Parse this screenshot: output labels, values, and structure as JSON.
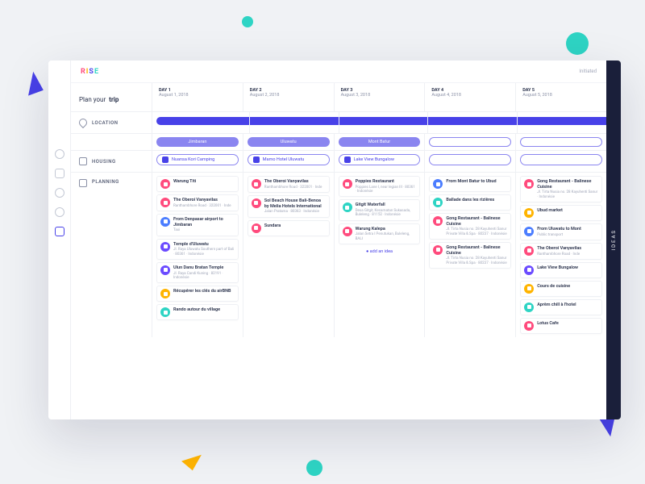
{
  "logo": [
    "R",
    "I",
    "S",
    "E"
  ],
  "topRight": "Initiated",
  "title1": "Plan your",
  "title2": "trip",
  "days": [
    {
      "n": "DAY 1",
      "d": "August 1, 2018"
    },
    {
      "n": "DAY 2",
      "d": "August 2, 2018"
    },
    {
      "n": "DAY 3",
      "d": "August 3, 2018"
    },
    {
      "n": "DAY 4",
      "d": "August 4, 2018"
    },
    {
      "n": "DAY 5",
      "d": "August 5, 2018"
    }
  ],
  "rows": {
    "location": "LOCATION",
    "housing": "HOUSING",
    "planning": "PLANNING"
  },
  "locationPills": [
    {
      "t": "Jimbaran",
      "s": true
    },
    {
      "t": "Uluwatu",
      "s": true
    },
    {
      "t": "Mont Batur",
      "s": true
    },
    {
      "t": "",
      "s": false
    },
    {
      "t": "",
      "s": false
    }
  ],
  "housing": [
    {
      "t": "Nuansa Kori Camping"
    },
    {
      "t": "Mamo Hotel Uluwatu"
    },
    {
      "t": "Lake View Bungalow"
    },
    {
      "t": ""
    },
    {
      "t": ""
    }
  ],
  "planning": [
    [
      {
        "c": "pink",
        "t": "Warung Titi",
        "s": ""
      },
      {
        "c": "pink",
        "t": "The Oberoi Vanyavilas",
        "s": "Ranthambhore Road · 322001 · Inde"
      },
      {
        "c": "blue",
        "t": "From Denpasar airport to Jimbaran",
        "s": "Taxi"
      },
      {
        "c": "purple",
        "t": "Temple d'Uluwatu",
        "s": "Jl. Raya Uluwatu Southern part of Bali · 80361 · Indonésie"
      },
      {
        "c": "purple",
        "t": "Ulun Danu Bratan Temple",
        "s": "Jl. Raya Candi Kuning · 82191 · Indonésie"
      },
      {
        "c": "yellow",
        "t": "Récupérer les clés du airBNB",
        "s": ""
      },
      {
        "c": "teal",
        "t": "Rando autour du village",
        "s": ""
      }
    ],
    [
      {
        "c": "pink",
        "t": "The Oberoi Vanyavilas",
        "s": "Ranthambhore Road · 322001 · Inde"
      },
      {
        "c": "pink",
        "t": "Sol Beach House Bali-Benoa by Melia Hotels International",
        "s": "Jalan Pratama · 80363 · Indonésie"
      },
      {
        "c": "pink",
        "t": "Sundara",
        "s": ""
      }
    ],
    [
      {
        "c": "pink",
        "t": "Poppies Restaurant",
        "s": "Poppies Lane I, near legian III · 80361 · Indonésie"
      },
      {
        "c": "teal",
        "t": "Gitgit Waterfall",
        "s": "Desa Gitgit, Kecamatan Sukasada, Buleleng · 81152 · Indonésie"
      },
      {
        "c": "pink",
        "t": "Warung Kalepa",
        "s": "Jalan Setra I Penutukan, Buleleng, BALI"
      }
    ],
    [
      {
        "c": "blue",
        "t": "From Mont Batur to Ubud",
        "s": ""
      },
      {
        "c": "teal",
        "t": "Ballade dans les rizières",
        "s": ""
      },
      {
        "c": "pink",
        "t": "Gong Restaurant - Balinese Cuisine",
        "s": "Jl. Tirta Nusia no. 28 Kayuhenti Sanur Private Villa & Spa · 80237 · Indonésie"
      },
      {
        "c": "pink",
        "t": "Gong Restaurant - Balinese Cuisine",
        "s": "Jl. Tirta Nusia no. 28 Kayuhenti Sanur Private Villa & Spa · 80237 · Indonésie"
      }
    ],
    [
      {
        "c": "pink",
        "t": "Gong Restaurant - Balinese Cuisine",
        "s": "Jl. Tirta Nusia no. 28 Kayuhenti Sanur · Indonésie"
      },
      {
        "c": "yellow",
        "t": "Ubud market",
        "s": ""
      },
      {
        "c": "blue",
        "t": "From Uluwatu to Mont",
        "s": "Public transport"
      },
      {
        "c": "pink",
        "t": "The Oberoi Vanyavilas",
        "s": "Ranthambhore Road · Inde"
      },
      {
        "c": "purple",
        "t": "Lake View Bungalow",
        "s": ""
      },
      {
        "c": "yellow",
        "t": "Cours de cuisine",
        "s": ""
      },
      {
        "c": "teal",
        "t": "Aprèm chill à l'hotel",
        "s": ""
      },
      {
        "c": "pink",
        "t": "Lotus Cafe",
        "s": ""
      }
    ]
  ],
  "addIdea": "● add an idea",
  "sideLabel": "IDEAS"
}
